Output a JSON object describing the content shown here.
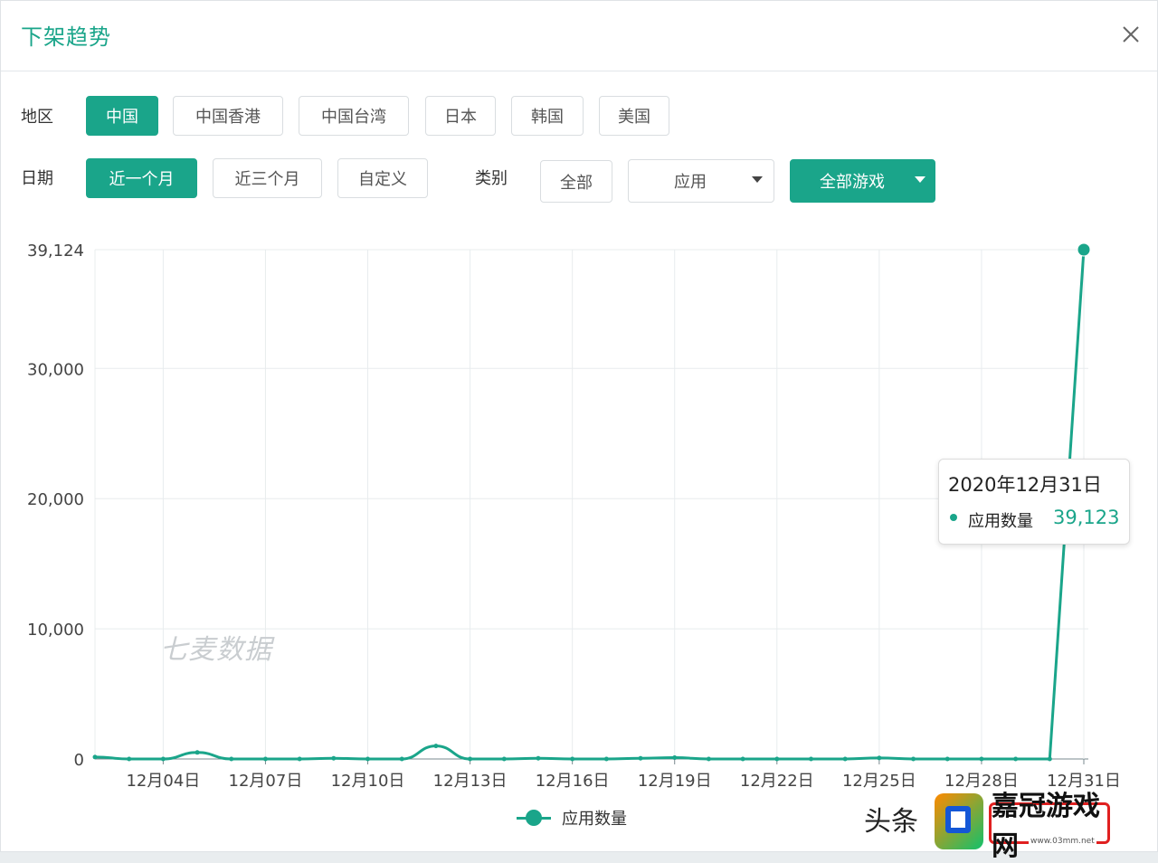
{
  "dialog": {
    "title": "下架趋势",
    "close_label": "×"
  },
  "filters": {
    "region_label": "地区",
    "regions": [
      "中国",
      "中国香港",
      "中国台湾",
      "日本",
      "韩国",
      "美国"
    ],
    "region_active": "中国",
    "date_label": "日期",
    "dates": [
      "近一个月",
      "近三个月",
      "自定义"
    ],
    "date_active": "近一个月",
    "category_label": "类别",
    "category_all": "全部",
    "category_select": "应用",
    "game_select": "全部游戏"
  },
  "chart_data": {
    "type": "line",
    "x": [
      "12月02日",
      "12月03日",
      "12月04日",
      "12月05日",
      "12月06日",
      "12月07日",
      "12月08日",
      "12月09日",
      "12月10日",
      "12月11日",
      "12月12日",
      "12月13日",
      "12月14日",
      "12月15日",
      "12月16日",
      "12月17日",
      "12月18日",
      "12月19日",
      "12月20日",
      "12月21日",
      "12月22日",
      "12月23日",
      "12月24日",
      "12月25日",
      "12月26日",
      "12月27日",
      "12月28日",
      "12月29日",
      "12月30日",
      "12月31日"
    ],
    "xticks": [
      "12月04日",
      "12月07日",
      "12月10日",
      "12月13日",
      "12月16日",
      "12月19日",
      "12月22日",
      "12月25日",
      "12月28日",
      "12月31日"
    ],
    "series": [
      {
        "name": "应用数量",
        "color": "#1aa58a",
        "values": [
          150,
          0,
          0,
          500,
          0,
          0,
          0,
          50,
          0,
          0,
          1000,
          0,
          0,
          50,
          0,
          0,
          50,
          100,
          0,
          0,
          0,
          0,
          0,
          80,
          0,
          0,
          0,
          0,
          0,
          39123
        ]
      }
    ],
    "yticks": [
      "0",
      "10,000",
      "20,000",
      "30,000",
      "39,124"
    ],
    "ylim": [
      0,
      39124
    ],
    "grid": true,
    "legend": "bottom-center"
  },
  "tooltip": {
    "date": "2020年12月31日",
    "series": "应用数量",
    "value": "39,123"
  },
  "watermark": "七麦数据",
  "legend": {
    "label": "应用数量"
  },
  "branding": {
    "left_text": "头条",
    "badge_text": "嘉冠游戏网",
    "url": "www.03mm.net"
  }
}
